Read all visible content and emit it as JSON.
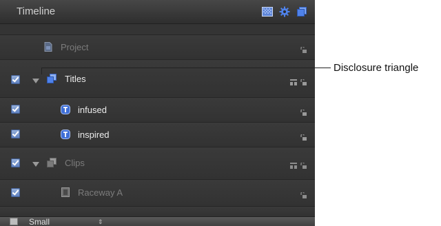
{
  "panel": {
    "title": "Timeline",
    "header_icons": [
      "checker-icon",
      "gear-icon",
      "layers-icon"
    ]
  },
  "layers": [
    {
      "name": "Project",
      "checked": false,
      "disclosure": false,
      "icon": "project-icon",
      "active": false
    },
    {
      "name": "Titles",
      "checked": true,
      "disclosure": true,
      "icon": "group-icon",
      "active": true
    },
    {
      "name": "infused",
      "checked": true,
      "disclosure": false,
      "icon": "text-layer-icon",
      "active": true
    },
    {
      "name": "inspired",
      "checked": true,
      "disclosure": false,
      "icon": "text-layer-icon",
      "active": true
    },
    {
      "name": "Clips",
      "checked": true,
      "disclosure": true,
      "icon": "group-icon",
      "active": false
    },
    {
      "name": "Raceway A",
      "checked": true,
      "disclosure": false,
      "icon": "clip-icon",
      "active": false
    }
  ],
  "footer": {
    "size_label": "Small",
    "size_arrows": "⇕"
  },
  "callout": {
    "label": "Disclosure triangle"
  }
}
